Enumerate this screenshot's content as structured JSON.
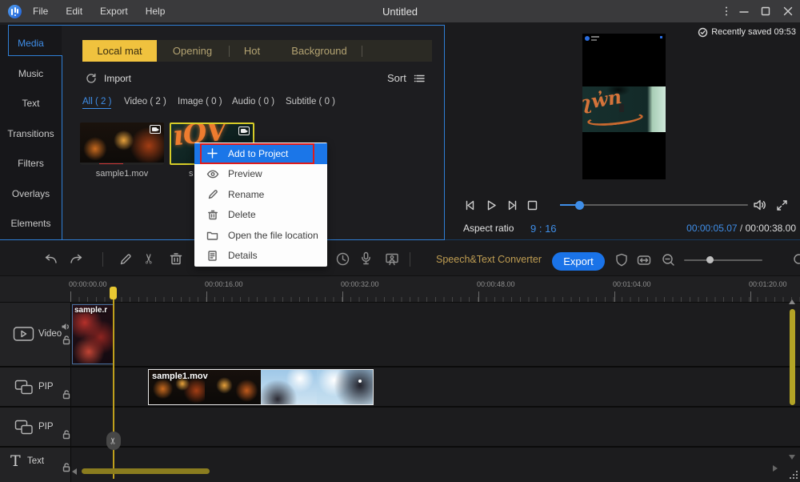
{
  "titlebar": {
    "menus": [
      {
        "label": "File"
      },
      {
        "label": "Edit"
      },
      {
        "label": "Export"
      },
      {
        "label": "Help"
      }
    ],
    "title": "Untitled"
  },
  "sidebar": {
    "items": [
      {
        "label": "Media",
        "active": true
      },
      {
        "label": "Music"
      },
      {
        "label": "Text"
      },
      {
        "label": "Transitions"
      },
      {
        "label": "Filters"
      },
      {
        "label": "Overlays"
      },
      {
        "label": "Elements"
      }
    ]
  },
  "media_panel": {
    "tabs": [
      {
        "label": "Local mat",
        "active": true
      },
      {
        "label": "Opening"
      },
      {
        "label": "Hot"
      },
      {
        "label": "Background"
      }
    ],
    "import_label": "Import",
    "sort_label": "Sort",
    "filters": [
      {
        "label": "All ( 2 )",
        "active": true
      },
      {
        "label": "Video ( 2 )"
      },
      {
        "label": "Image ( 0 )"
      },
      {
        "label": "Audio ( 0 )"
      },
      {
        "label": "Subtitle ( 0 )"
      }
    ],
    "items": [
      {
        "name": "sample1.mov"
      },
      {
        "name": "s",
        "selected": true
      }
    ]
  },
  "context_menu": {
    "items": [
      {
        "label": "Add to Project",
        "icon": "plus-icon",
        "highlighted": true,
        "annotated": true
      },
      {
        "label": "Preview",
        "icon": "eye-icon"
      },
      {
        "label": "Rename",
        "icon": "pencil-icon"
      },
      {
        "label": "Delete",
        "icon": "trash-icon"
      },
      {
        "label": "Open the file location",
        "icon": "folder-icon"
      },
      {
        "label": "Details",
        "icon": "document-icon"
      }
    ]
  },
  "preview": {
    "saved_status": "Recently saved 09:53",
    "aspect_ratio_label": "Aspect ratio",
    "aspect_ratio_value": "9 : 16",
    "current_time": "00:00:05.07",
    "time_separator": "/",
    "total_time": "00:00:38.00",
    "seek_progress_pct": 11
  },
  "toolbar": {
    "speech_text_label": "Speech&Text Converter",
    "export_label": "Export",
    "zoom_slider_pct": 33
  },
  "timeline": {
    "ruler_labels": [
      "00:00:00.00",
      "00:00:16.00",
      "00:00:32.00",
      "00:00:48.00",
      "00:01:04.00",
      "00:01:20.00"
    ],
    "tracks": [
      {
        "label": "Video",
        "muted": false,
        "locked": false
      },
      {
        "label": "PIP",
        "locked": false
      },
      {
        "label": "PIP",
        "locked": false
      },
      {
        "label": "Text",
        "locked": false
      }
    ],
    "clips": [
      {
        "label": "sample.r",
        "track": "Video"
      },
      {
        "label": "sample1.mov",
        "track": "PIP"
      }
    ],
    "playhead_time_s": 5.07
  },
  "colors": {
    "accent_blue": "#2f7fd6",
    "link_blue": "#3f8ee8",
    "tab_yellow": "#f0c23e",
    "annotation_red": "#e01b1b",
    "playhead_yellow": "#e6c122",
    "export_blue": "#1a73e8",
    "gold_text": "#bf9d52",
    "scrollbar_olive": "#8a7c1f"
  }
}
